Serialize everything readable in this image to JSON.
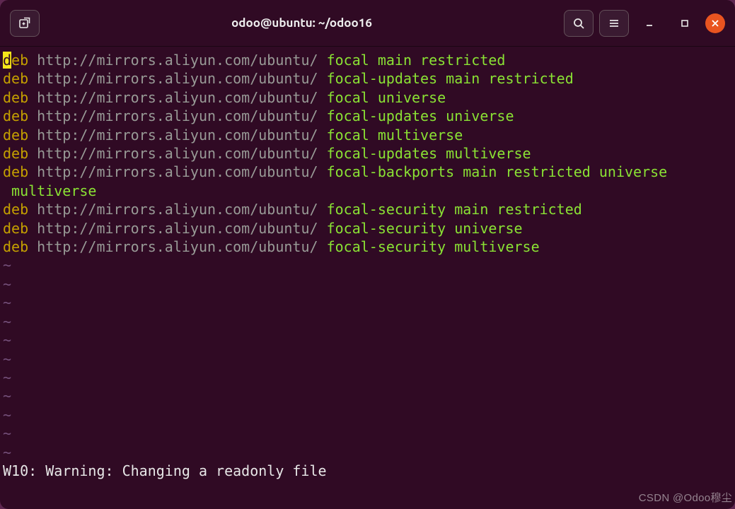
{
  "window": {
    "title": "odoo@ubuntu: ~/odoo16"
  },
  "lines": [
    {
      "deb": "deb",
      "url": "http://mirrors.aliyun.com/ubuntu/",
      "components": "focal main restricted",
      "cursor": true
    },
    {
      "deb": "deb",
      "url": "http://mirrors.aliyun.com/ubuntu/",
      "components": "focal-updates main restricted"
    },
    {
      "deb": "deb",
      "url": "http://mirrors.aliyun.com/ubuntu/",
      "components": "focal universe"
    },
    {
      "deb": "deb",
      "url": "http://mirrors.aliyun.com/ubuntu/",
      "components": "focal-updates universe"
    },
    {
      "deb": "deb",
      "url": "http://mirrors.aliyun.com/ubuntu/",
      "components": "focal multiverse"
    },
    {
      "deb": "deb",
      "url": "http://mirrors.aliyun.com/ubuntu/",
      "components": "focal-updates multiverse"
    },
    {
      "deb": "deb",
      "url": "http://mirrors.aliyun.com/ubuntu/",
      "components": "focal-backports main restricted universe"
    },
    {
      "wrap": " multiverse"
    },
    {
      "deb": "deb",
      "url": "http://mirrors.aliyun.com/ubuntu/",
      "components": "focal-security main restricted"
    },
    {
      "deb": "deb",
      "url": "http://mirrors.aliyun.com/ubuntu/",
      "components": "focal-security universe"
    },
    {
      "deb": "deb",
      "url": "http://mirrors.aliyun.com/ubuntu/",
      "components": "focal-security multiverse"
    }
  ],
  "tildes_count": 11,
  "tilde": "~",
  "status": "W10: Warning: Changing a readonly file",
  "watermark": "CSDN @Odoo穆尘"
}
